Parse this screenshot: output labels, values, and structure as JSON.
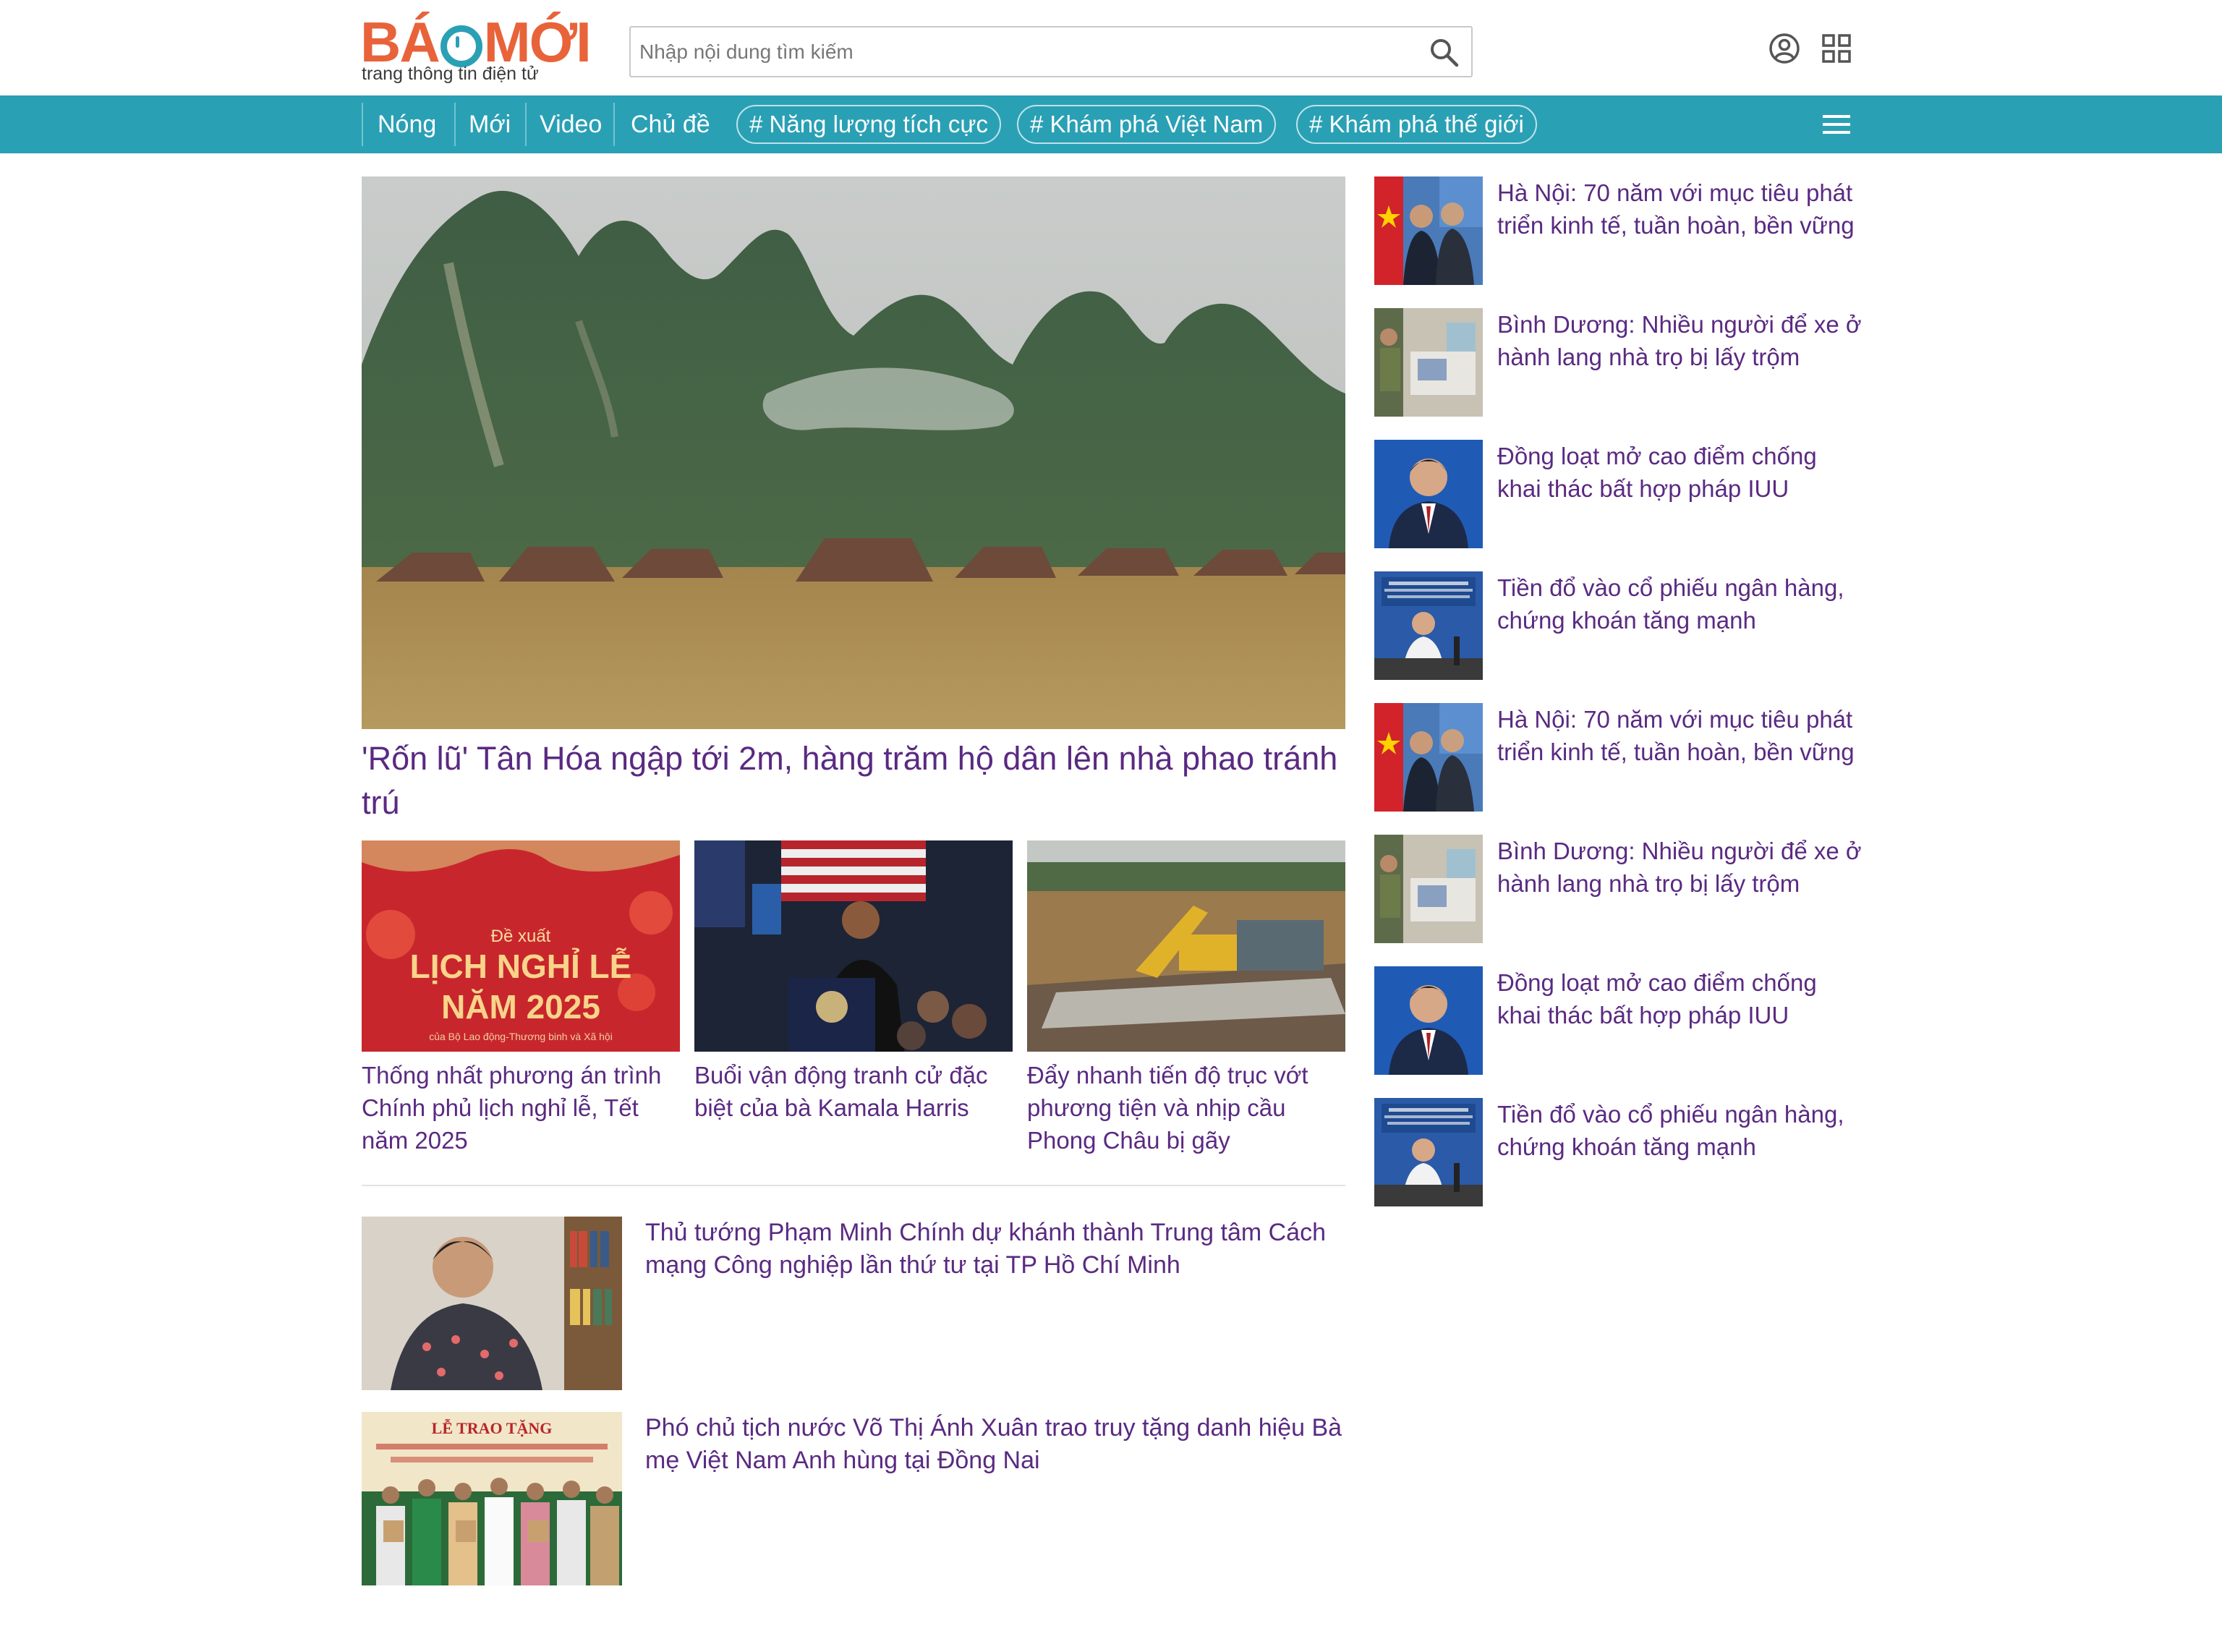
{
  "header": {
    "logo": {
      "brand": "BÁOMỚI",
      "tagline": "trang thông tin điện tử"
    },
    "search": {
      "placeholder": "Nhập nội dung tìm kiếm"
    }
  },
  "nav": {
    "items": [
      "Nóng",
      "Mới",
      "Video",
      "Chủ đề"
    ],
    "tags": [
      "# Năng lượng tích cực",
      "# Khám phá Việt Nam",
      "# Khám phá thế giới"
    ]
  },
  "hero": {
    "title": "'Rốn lũ' Tân Hóa ngập tới 2m, hàng trăm hộ dân lên nhà phao tránh trú"
  },
  "sub_articles": [
    {
      "title": "Thống nhất phương án trình Chính phủ lịch nghỉ lễ, Tết năm 2025",
      "image_text": {
        "line1": "Đề xuất",
        "line2": "LỊCH NGHỈ LỄ",
        "line3": "NĂM 2025",
        "line4": "của Bộ Lao động-Thương binh và Xã hội"
      }
    },
    {
      "title": "Buổi vận động tranh cử đặc biệt của bà Kamala Harris"
    },
    {
      "title": "Đẩy nhanh tiến độ trục vớt phương tiện và nhịp cầu Phong Châu bị gãy"
    }
  ],
  "list_articles": [
    {
      "title": "Thủ tướng Phạm Minh Chính dự khánh thành Trung tâm Cách mạng Công nghiệp lần thứ tư tại TP Hồ Chí Minh"
    },
    {
      "title": "Phó chủ tịch nước Võ Thị Ánh Xuân trao truy tặng danh hiệu Bà mẹ Việt Nam Anh hùng tại Đồng Nai",
      "image_text": "LỄ TRAO TẶNG"
    }
  ],
  "sidebar": [
    {
      "title": "Hà Nội: 70 năm với mục tiêu phát triển kinh tế, tuần hoàn, bền vững"
    },
    {
      "title": "Bình Dương: Nhiều người để xe ở hành lang nhà trọ bị lấy trộm"
    },
    {
      "title": "Đồng loạt mở cao điểm chống khai thác bất hợp pháp IUU"
    },
    {
      "title": "Tiền đổ vào cổ phiếu ngân hàng, chứng khoán tăng mạnh"
    },
    {
      "title": "Hà Nội: 70 năm với mục tiêu phát triển kinh tế, tuần hoàn, bền vững"
    },
    {
      "title": "Bình Dương: Nhiều người để xe ở hành lang nhà trọ bị lấy trộm"
    },
    {
      "title": "Đồng loạt mở cao điểm chống khai thác bất hợp pháp IUU"
    },
    {
      "title": "Tiền đổ vào cổ phiếu ngân hàng, chứng khoán tăng mạnh"
    }
  ],
  "colors": {
    "brand_orange": "#e8633a",
    "brand_teal": "#2aa0b5",
    "title_purple": "#5a2a82"
  },
  "icons": [
    "search-icon",
    "user-icon",
    "grid-icon",
    "menu-icon"
  ]
}
